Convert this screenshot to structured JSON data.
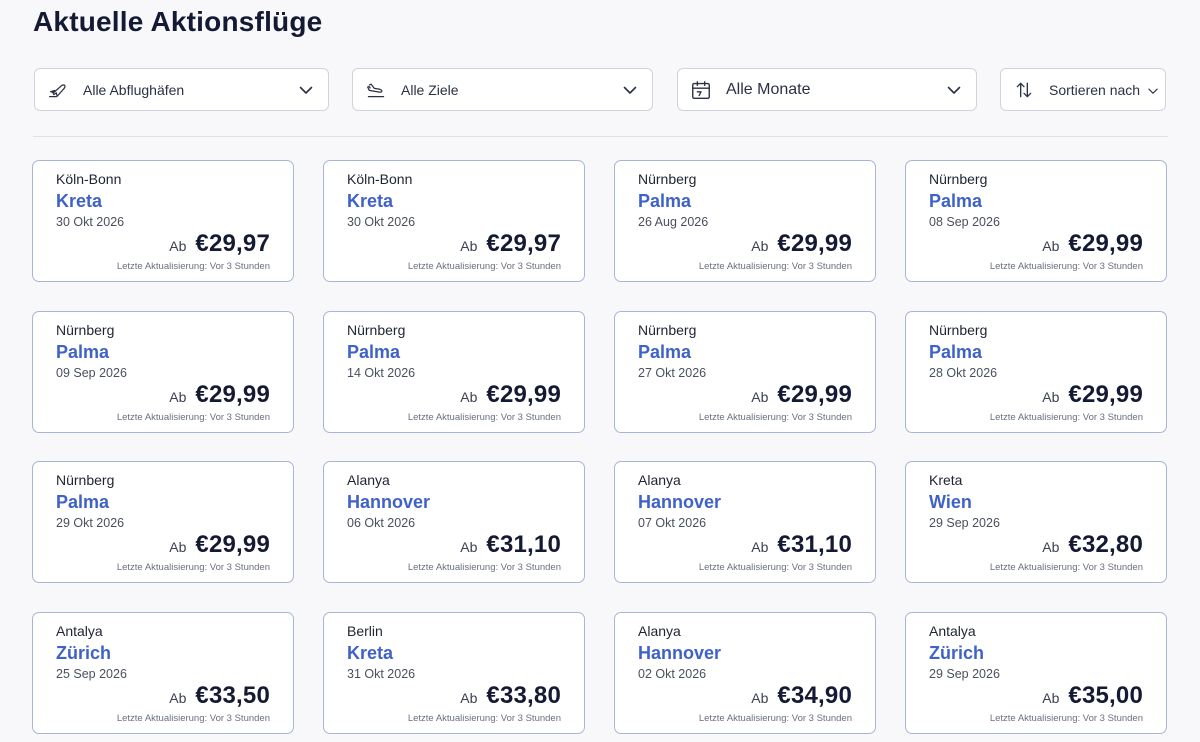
{
  "page": {
    "title": "Aktuelle Aktionsflüge"
  },
  "filters": {
    "departure": {
      "label": "Alle Abflughäfen",
      "icon": "plane-departure-icon"
    },
    "destination": {
      "label": "Alle Ziele",
      "icon": "plane-arrival-icon"
    },
    "month": {
      "label": "Alle Monate",
      "icon": "calendar-icon"
    },
    "sort": {
      "label": "Sortieren nach",
      "icon": "sort-arrows-icon"
    }
  },
  "cards": [
    {
      "origin": "Köln-Bonn",
      "destination": "Kreta",
      "date": "30 Okt 2026",
      "prefix": "Ab",
      "price": "€29,97",
      "updated": "Letzte Aktualisierung: Vor 3 Stunden"
    },
    {
      "origin": "Köln-Bonn",
      "destination": "Kreta",
      "date": "30 Okt 2026",
      "prefix": "Ab",
      "price": "€29,97",
      "updated": "Letzte Aktualisierung: Vor 3 Stunden"
    },
    {
      "origin": "Nürnberg",
      "destination": "Palma",
      "date": "26 Aug 2026",
      "prefix": "Ab",
      "price": "€29,99",
      "updated": "Letzte Aktualisierung: Vor 3 Stunden"
    },
    {
      "origin": "Nürnberg",
      "destination": "Palma",
      "date": "08 Sep 2026",
      "prefix": "Ab",
      "price": "€29,99",
      "updated": "Letzte Aktualisierung: Vor 3 Stunden"
    },
    {
      "origin": "Nürnberg",
      "destination": "Palma",
      "date": "09 Sep 2026",
      "prefix": "Ab",
      "price": "€29,99",
      "updated": "Letzte Aktualisierung: Vor 3 Stunden"
    },
    {
      "origin": "Nürnberg",
      "destination": "Palma",
      "date": "14 Okt 2026",
      "prefix": "Ab",
      "price": "€29,99",
      "updated": "Letzte Aktualisierung: Vor 3 Stunden"
    },
    {
      "origin": "Nürnberg",
      "destination": "Palma",
      "date": "27 Okt 2026",
      "prefix": "Ab",
      "price": "€29,99",
      "updated": "Letzte Aktualisierung: Vor 3 Stunden"
    },
    {
      "origin": "Nürnberg",
      "destination": "Palma",
      "date": "28 Okt 2026",
      "prefix": "Ab",
      "price": "€29,99",
      "updated": "Letzte Aktualisierung: Vor 3 Stunden"
    },
    {
      "origin": "Nürnberg",
      "destination": "Palma",
      "date": "29 Okt 2026",
      "prefix": "Ab",
      "price": "€29,99",
      "updated": "Letzte Aktualisierung: Vor 3 Stunden"
    },
    {
      "origin": "Alanya",
      "destination": "Hannover",
      "date": "06 Okt 2026",
      "prefix": "Ab",
      "price": "€31,10",
      "updated": "Letzte Aktualisierung: Vor 3 Stunden"
    },
    {
      "origin": "Alanya",
      "destination": "Hannover",
      "date": "07 Okt 2026",
      "prefix": "Ab",
      "price": "€31,10",
      "updated": "Letzte Aktualisierung: Vor 3 Stunden"
    },
    {
      "origin": "Kreta",
      "destination": "Wien",
      "date": "29 Sep 2026",
      "prefix": "Ab",
      "price": "€32,80",
      "updated": "Letzte Aktualisierung: Vor 3 Stunden"
    },
    {
      "origin": "Antalya",
      "destination": "Zürich",
      "date": "25 Sep 2026",
      "prefix": "Ab",
      "price": "€33,50",
      "updated": "Letzte Aktualisierung: Vor 3 Stunden"
    },
    {
      "origin": "Berlin",
      "destination": "Kreta",
      "date": "31 Okt 2026",
      "prefix": "Ab",
      "price": "€33,80",
      "updated": "Letzte Aktualisierung: Vor 3 Stunden"
    },
    {
      "origin": "Alanya",
      "destination": "Hannover",
      "date": "02 Okt 2026",
      "prefix": "Ab",
      "price": "€34,90",
      "updated": "Letzte Aktualisierung: Vor 3 Stunden"
    },
    {
      "origin": "Antalya",
      "destination": "Zürich",
      "date": "29 Sep 2026",
      "prefix": "Ab",
      "price": "€35,00",
      "updated": "Letzte Aktualisierung: Vor 3 Stunden"
    }
  ],
  "colors": {
    "accent": "#3f62c9",
    "card_border": "#a9b5d6",
    "title": "#141a33"
  }
}
